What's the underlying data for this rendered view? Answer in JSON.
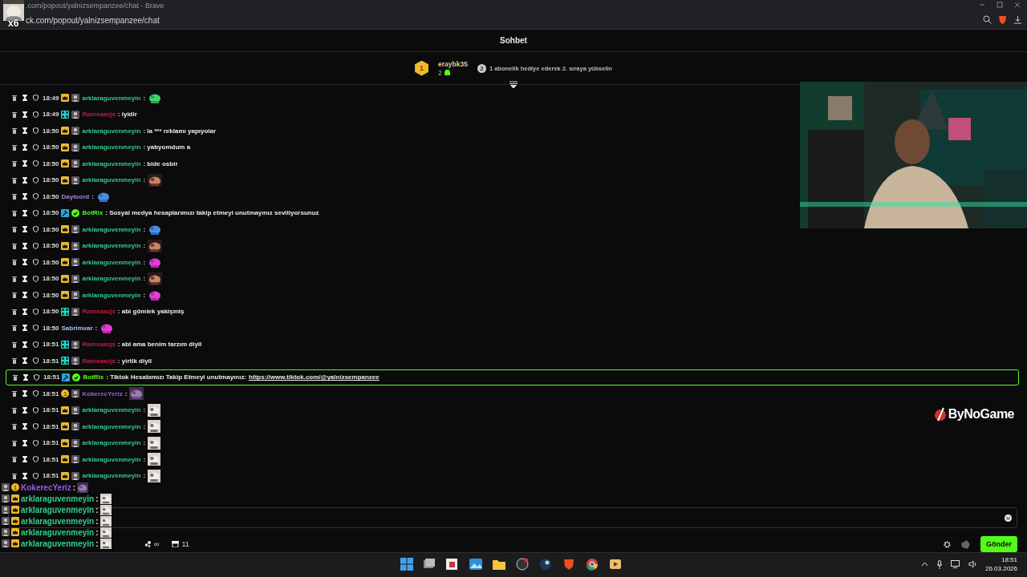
{
  "browser": {
    "title": ".com/popout/yalnizsempanzee/chat - Brave",
    "url": "ck.com/popout/yalnizsempanzee/chat",
    "overlay_emote": {
      "kind": "picture",
      "count": "x6"
    }
  },
  "chat_header": {
    "title": "Sohbet"
  },
  "leaderboard": {
    "rank": "1",
    "user": "eraybk35",
    "gifts": "2",
    "hint_rank": "2",
    "hint": "1 abonelik hediye ederek 2. sıraya yükselin"
  },
  "messages": [
    {
      "time": "18:49",
      "badges": [
        {
          "kind": "crown"
        },
        {
          "kind": "avatar"
        }
      ],
      "user": "arklaraguvenmeyin",
      "color": "#2fcf8a",
      "text": ":",
      "highlighted": false
    },
    {
      "time": "18:49",
      "badges": [
        {
          "kind": "grid"
        },
        {
          "kind": "avatar"
        }
      ],
      "user": "Ramxaazjs",
      "color": "#c8193f",
      "text": ": iyidir",
      "highlighted": false
    },
    {
      "time": "18:50",
      "badges": [
        {
          "kind": "crown"
        },
        {
          "kind": "avatar"
        }
      ],
      "user": "arklaraguvenmeyin",
      "color": "#2fcf8a",
      "text": ": la *** reklamı yapıyolar",
      "highlighted": false
    },
    {
      "time": "18:50",
      "badges": [
        {
          "kind": "crown"
        },
        {
          "kind": "avatar"
        }
      ],
      "user": "arklaraguvenmeyin",
      "color": "#2fcf8a",
      "text": ": yatıyomdum a",
      "highlighted": false
    },
    {
      "time": "18:50",
      "badges": [
        {
          "kind": "crown"
        },
        {
          "kind": "avatar"
        }
      ],
      "user": "arklaraguvenmeyin",
      "color": "#2fcf8a",
      "text": ": bide osbir",
      "highlighted": false
    },
    {
      "time": "18:50",
      "badges": [
        {
          "kind": "crown"
        },
        {
          "kind": "avatar"
        }
      ],
      "user": "arklaraguvenmeyin",
      "color": "#2fcf8a",
      "text": ":",
      "highlighted": false
    },
    {
      "time": "18:50",
      "user": "Dayloord",
      "color": "#b07ee8",
      "text": ":",
      "highlighted": false
    },
    {
      "time": "18:50",
      "badges": [
        {
          "kind": "hammer"
        },
        {
          "kind": "verified"
        }
      ],
      "user": "BotRix",
      "color": "#53fc18",
      "text": ": Sosyal medya hesaplarımızı takip etmeyi unutmayınız seviliyorsunuz",
      "highlighted": false
    },
    {
      "time": "18:50",
      "badges": [
        {
          "kind": "crown"
        },
        {
          "kind": "avatar"
        }
      ],
      "user": "arklaraguvenmeyin",
      "color": "#2fcf8a",
      "text": ":",
      "highlighted": false
    },
    {
      "time": "18:50",
      "badges": [
        {
          "kind": "crown"
        },
        {
          "kind": "avatar"
        }
      ],
      "user": "arklaraguvenmeyin",
      "color": "#2fcf8a",
      "text": ":",
      "highlighted": false
    },
    {
      "time": "18:50",
      "badges": [
        {
          "kind": "crown"
        },
        {
          "kind": "avatar"
        }
      ],
      "user": "arklaraguvenmeyin",
      "color": "#2fcf8a",
      "text": ":",
      "highlighted": false
    },
    {
      "time": "18:50",
      "badges": [
        {
          "kind": "crown"
        },
        {
          "kind": "avatar"
        }
      ],
      "user": "arklaraguvenmeyin",
      "color": "#2fcf8a",
      "text": ":",
      "highlighted": false
    },
    {
      "time": "18:50",
      "badges": [
        {
          "kind": "crown"
        },
        {
          "kind": "avatar"
        }
      ],
      "user": "arklaraguvenmeyin",
      "color": "#2fcf8a",
      "text": ":",
      "highlighted": false
    },
    {
      "time": "18:50",
      "badges": [
        {
          "kind": "grid"
        },
        {
          "kind": "avatar"
        }
      ],
      "user": "Ramxaazjs",
      "color": "#c8193f",
      "text": ": abi gömlek yakişmiş",
      "highlighted": false
    },
    {
      "time": "18:50",
      "user": "Sabrimvar",
      "color": "#a9bff5",
      "text": ":",
      "highlighted": false
    },
    {
      "time": "18:51",
      "badges": [
        {
          "kind": "grid"
        },
        {
          "kind": "avatar"
        }
      ],
      "user": "Ramxaazjs",
      "color": "#c8193f",
      "text": ": abi ama benim tarzım diyil",
      "highlighted": false
    },
    {
      "time": "18:51",
      "badges": [
        {
          "kind": "grid"
        },
        {
          "kind": "avatar"
        }
      ],
      "user": "Ramxaazjs",
      "color": "#c8193f",
      "text": ": yirtik diyil",
      "highlighted": false
    },
    {
      "time": "18:51",
      "badges": [
        {
          "kind": "hammer"
        },
        {
          "kind": "verified"
        }
      ],
      "user": "BotRix",
      "color": "#53fc18",
      "text": ": Tiktok Hesabımızı Takip Etmeyi unutmayınız:",
      "link": "https://www.tiktok.com/@yalnizsempanzee",
      "highlighted": true
    },
    {
      "time": "18:51",
      "badges": [
        {
          "kind": "coin",
          "label": "1"
        },
        {
          "kind": "avatar"
        }
      ],
      "user": "KokerecYeriz",
      "color": "#9b5de5",
      "text": ":",
      "highlighted": false
    },
    {
      "time": "18:51",
      "badges": [
        {
          "kind": "crown"
        },
        {
          "kind": "avatar"
        }
      ],
      "user": "arklaraguvenmeyin",
      "color": "#2fcf8a",
      "text": ":",
      "highlighted": false
    },
    {
      "time": "18:51",
      "badges": [
        {
          "kind": "crown"
        },
        {
          "kind": "avatar"
        }
      ],
      "user": "arklaraguvenmeyin",
      "color": "#2fcf8a",
      "text": ":",
      "highlighted": false
    },
    {
      "time": "18:51",
      "badges": [
        {
          "kind": "crown"
        },
        {
          "kind": "avatar"
        }
      ],
      "user": "arklaraguvenmeyin",
      "color": "#2fcf8a",
      "text": ":",
      "highlighted": false
    },
    {
      "time": "18:51",
      "badges": [
        {
          "kind": "crown"
        },
        {
          "kind": "avatar"
        }
      ],
      "user": "arklaraguvenmeyin",
      "color": "#2fcf8a",
      "text": ":",
      "highlighted": false
    },
    {
      "time": "18:51",
      "badges": [
        {
          "kind": "crown"
        },
        {
          "kind": "avatar"
        }
      ],
      "user": "arklaraguvenmeyin",
      "color": "#2fcf8a",
      "text": ":",
      "highlighted": false
    }
  ],
  "stream": {
    "sponsor": "ByNoGame",
    "overlay_chat": [
      {
        "badges": [
          {
            "kind": "avatar"
          },
          {
            "kind": "coin",
            "label": "1"
          }
        ],
        "user": "KokerecYeriz",
        "color": "#9b5de5",
        "text": ":"
      },
      {
        "badges": [
          {
            "kind": "avatar"
          },
          {
            "kind": "crown"
          }
        ],
        "user": "arklaraguvenmeyin",
        "color": "#2fcf8a",
        "text": ":"
      },
      {
        "badges": [
          {
            "kind": "avatar"
          },
          {
            "kind": "crown"
          }
        ],
        "user": "arklaraguvenmeyin",
        "color": "#2fcf8a",
        "text": ":"
      },
      {
        "badges": [
          {
            "kind": "avatar"
          },
          {
            "kind": "crown"
          }
        ],
        "user": "arklaraguvenmeyin",
        "color": "#2fcf8a",
        "text": ":"
      },
      {
        "badges": [
          {
            "kind": "avatar"
          },
          {
            "kind": "crown"
          }
        ],
        "user": "arklaraguvenmeyin",
        "color": "#2fcf8a",
        "text": ":"
      },
      {
        "badges": [
          {
            "kind": "avatar"
          },
          {
            "kind": "crown"
          }
        ],
        "user": "arklaraguvenmeyin",
        "color": "#2fcf8a",
        "text": ":"
      }
    ]
  },
  "composer": {
    "points": "∞",
    "store_count": "11",
    "send": "Gönder"
  },
  "taskbar": {
    "time": "18:51",
    "date": "26.03.2026"
  }
}
